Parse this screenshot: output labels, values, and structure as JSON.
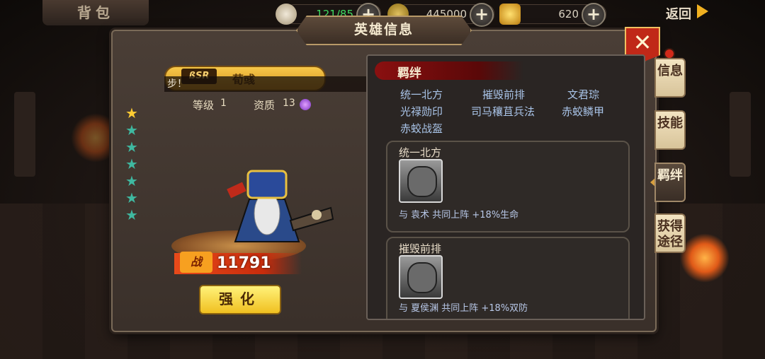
{
  "topbar": {
    "back_title": "背包",
    "resources": [
      {
        "icon": "garlic-icon",
        "value": "121/85"
      },
      {
        "icon": "copper-coin-icon",
        "value": "445000"
      },
      {
        "icon": "gold-ingot-icon",
        "value": "620"
      }
    ],
    "plus_label": "+",
    "return_label": "返回"
  },
  "panel": {
    "title": "英雄信息",
    "close_label": "✕"
  },
  "hero": {
    "badge": "ßSR",
    "name": "荀彧",
    "ticker": "步！",
    "level_label": "等级",
    "level": "1",
    "aptitude_label": "资质",
    "aptitude": "13",
    "stars_total": 7,
    "stars_gold": 1,
    "power_icon_label": "战",
    "power": "11791",
    "upgrade_label": "强化"
  },
  "bonds": {
    "header": "羁绊",
    "list": [
      "统一北方",
      "摧毁前排",
      "文君琮",
      "光禄勋印",
      "司马穰苴兵法",
      "赤蛟鳞甲",
      "赤蛟战盔"
    ],
    "cards": [
      {
        "title": "统一北方",
        "desc": "与 袁术 共同上阵 +18%生命"
      },
      {
        "title": "摧毁前排",
        "desc": "与 夏侯渊 共同上阵 +18%双防"
      }
    ]
  },
  "tabs": [
    {
      "label": "信息",
      "active": false
    },
    {
      "label": "技能",
      "active": false
    },
    {
      "label": "羁绊",
      "active": true
    },
    {
      "label": "获得途径",
      "active": false
    }
  ],
  "colors": {
    "gold": "#ffcc33",
    "teal_star": "#3fb8a0",
    "close_red": "#c02818",
    "bond_text": "#a9c4e8"
  }
}
